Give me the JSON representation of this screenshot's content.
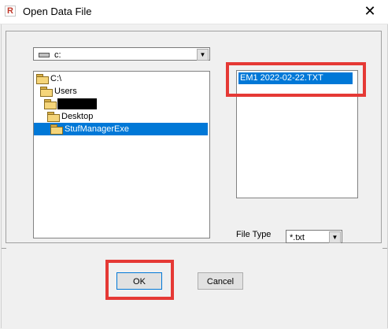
{
  "window": {
    "title": "Open Data File",
    "close_glyph": "✕",
    "app_icon_glyph": "R"
  },
  "drive_combo": {
    "value": "c:",
    "icon": "drive-icon",
    "arrow_icon": "chevron-down-icon"
  },
  "directory_tree": {
    "items": [
      {
        "label": "C:\\",
        "icon": "open-folder-icon",
        "selected": false
      },
      {
        "label": "Users",
        "icon": "open-folder-icon",
        "selected": false
      },
      {
        "label": "",
        "icon": "open-folder-icon",
        "selected": false,
        "redacted": true
      },
      {
        "label": "Desktop",
        "icon": "open-folder-icon",
        "selected": false
      },
      {
        "label": "StufManagerExe",
        "icon": "open-folder-icon",
        "selected": true
      }
    ]
  },
  "file_list": {
    "items": [
      "EM1 2022-02-22.TXT"
    ]
  },
  "file_type": {
    "label": "File Type",
    "value": "*.txt",
    "arrow_icon": "chevron-down-icon"
  },
  "buttons": {
    "ok": "OK",
    "cancel": "Cancel"
  },
  "colors": {
    "selection": "#0078d7",
    "highlight_box": "#e53935"
  }
}
